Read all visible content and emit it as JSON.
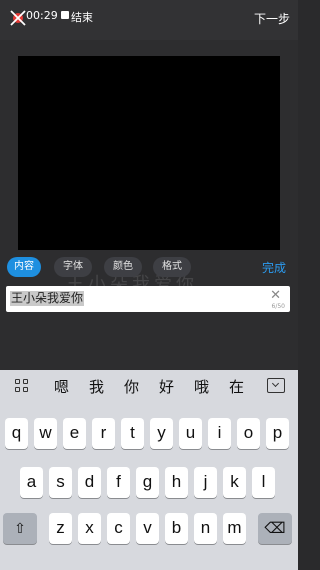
{
  "status": {
    "timer": "00:29",
    "stop_label": "结束",
    "next_label": "下一步"
  },
  "overlay_text": "王小朵我爱你",
  "tabs": [
    {
      "label": "内容",
      "active": true
    },
    {
      "label": "字体",
      "active": false
    },
    {
      "label": "颜色",
      "active": false
    },
    {
      "label": "格式",
      "active": false
    }
  ],
  "done_label": "完成",
  "input": {
    "value": "王小朵我爱你",
    "counter": "6/50"
  },
  "candidates": [
    "嗯",
    "我",
    "你",
    "好",
    "哦",
    "在"
  ],
  "keyboard": {
    "row1": [
      "q",
      "w",
      "e",
      "r",
      "t",
      "y",
      "u",
      "i",
      "o",
      "p"
    ],
    "row2": [
      "a",
      "s",
      "d",
      "f",
      "g",
      "h",
      "j",
      "k",
      "l"
    ],
    "row3": [
      "z",
      "x",
      "c",
      "v",
      "b",
      "n",
      "m"
    ]
  },
  "colors": {
    "accent": "#1e8fe0",
    "done": "#2b9bf0",
    "record": "#e53935"
  }
}
